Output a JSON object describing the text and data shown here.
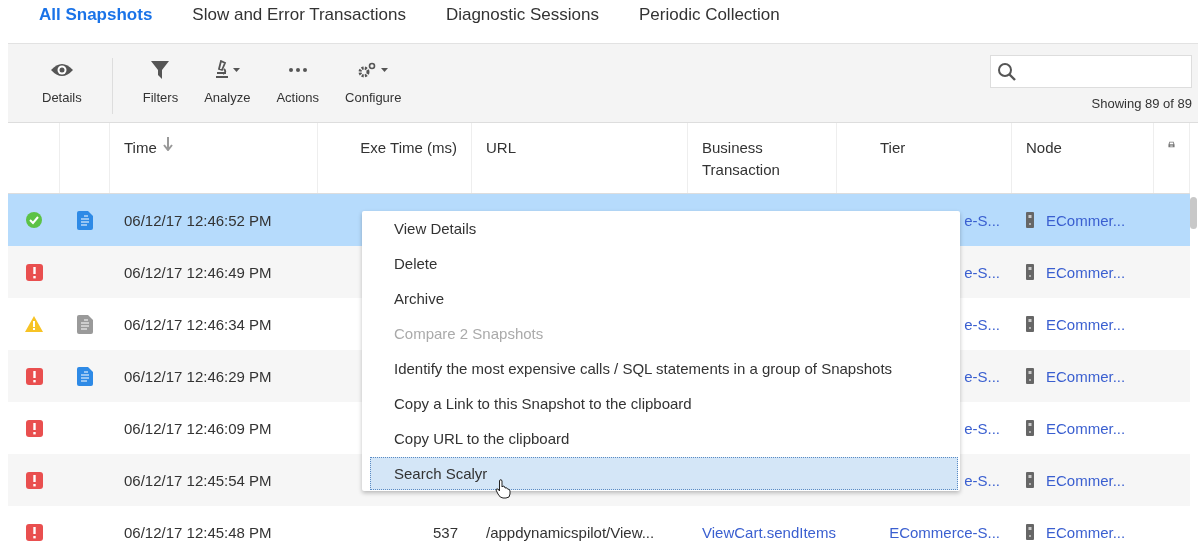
{
  "tabs": [
    {
      "label": "All Snapshots",
      "selected": true
    },
    {
      "label": "Slow and Error Transactions",
      "selected": false
    },
    {
      "label": "Diagnostic Sessions",
      "selected": false
    },
    {
      "label": "Periodic Collection",
      "selected": false
    }
  ],
  "toolbar": {
    "buttons": [
      {
        "label": "Details",
        "kind": "eye",
        "dropdown": false
      },
      {
        "label": "Filters",
        "kind": "filter",
        "dropdown": false
      },
      {
        "label": "Analyze",
        "kind": "microscope",
        "dropdown": true
      },
      {
        "label": "Actions",
        "kind": "dots",
        "dropdown": false
      },
      {
        "label": "Configure",
        "kind": "gears",
        "dropdown": true
      }
    ],
    "count": "Showing 89 of 89"
  },
  "table": {
    "columns": [
      "Time",
      "Exe Time (ms)",
      "URL",
      "Business Transaction",
      "Tier",
      "Node"
    ],
    "rows": [
      {
        "status": {
          "kind": "success"
        },
        "snapshot": {
          "kind": "full"
        },
        "time": "06/12/17 12:46:52 PM",
        "tier": "e-S...",
        "node": "ECommer...",
        "selected": true
      },
      {
        "status": {
          "kind": "error"
        },
        "time": "06/12/17 12:46:49 PM",
        "tier": "e-S...",
        "node": "ECommer...",
        "selected": false
      },
      {
        "status": {
          "kind": "warning"
        },
        "snapshot": {
          "kind": "partial"
        },
        "time": "06/12/17 12:46:34 PM",
        "tier": "e-S...",
        "node": "ECommer...",
        "selected": false
      },
      {
        "status": {
          "kind": "error"
        },
        "snapshot": {
          "kind": "full"
        },
        "time": "06/12/17 12:46:29 PM",
        "tier": "e-S...",
        "node": "ECommer...",
        "selected": false
      },
      {
        "status": {
          "kind": "error"
        },
        "time": "06/12/17 12:46:09 PM",
        "tier": "e-S...",
        "node": "ECommer...",
        "selected": false
      },
      {
        "status": {
          "kind": "error"
        },
        "time": "06/12/17 12:45:54 PM",
        "tier": "e-S...",
        "node": "ECommer...",
        "selected": false
      },
      {
        "status": {
          "kind": "error"
        },
        "time": "06/12/17 12:45:48 PM",
        "exe_time": "537",
        "url": "/appdynamicspilot/View...",
        "business_transaction": "ViewCart.sendItems",
        "tier": "ECommerce-S...",
        "node": "ECommer...",
        "selected": false
      }
    ]
  },
  "context_menu": {
    "items": [
      {
        "label": "View Details",
        "disabled": false,
        "selected": false
      },
      {
        "label": "Delete",
        "disabled": false,
        "selected": false
      },
      {
        "label": "Archive",
        "disabled": false,
        "selected": false
      },
      {
        "label": "Compare 2 Snapshots",
        "disabled": true,
        "selected": false
      },
      {
        "label": "Identify the most expensive calls / SQL statements in a group of Snapshots",
        "disabled": false,
        "selected": false
      },
      {
        "label": "Copy a Link to this Snapshot to the clipboard",
        "disabled": false,
        "selected": false
      },
      {
        "label": "Copy URL to the clipboard",
        "disabled": false,
        "selected": false
      },
      {
        "label": "Search Scalyr",
        "disabled": false,
        "selected": true
      }
    ]
  }
}
